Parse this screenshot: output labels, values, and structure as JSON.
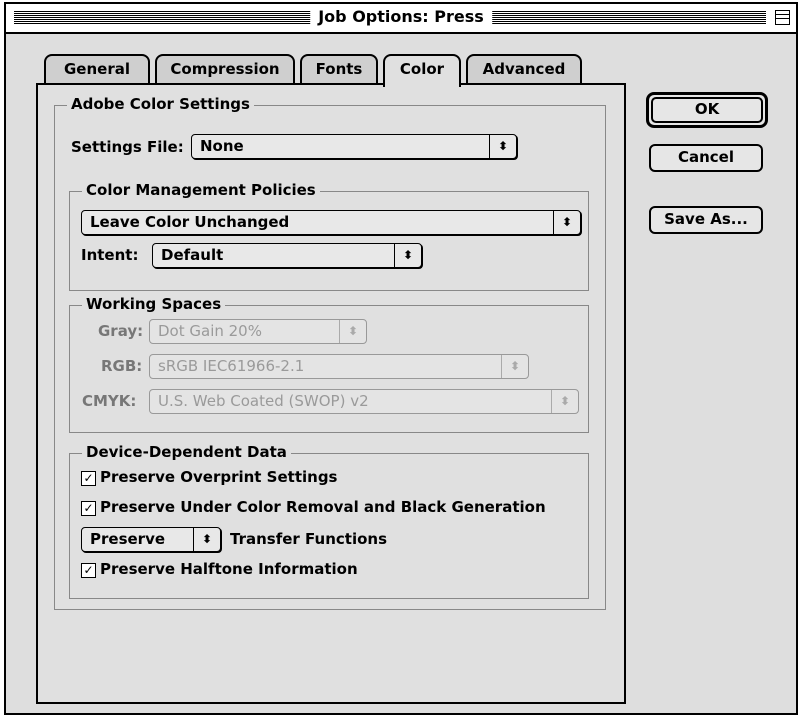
{
  "window": {
    "title": "Job Options: Press"
  },
  "tabs": [
    {
      "label": "General"
    },
    {
      "label": "Compression"
    },
    {
      "label": "Fonts"
    },
    {
      "label": "Color",
      "active": true
    },
    {
      "label": "Advanced"
    }
  ],
  "adobe_color_settings": {
    "title": "Adobe Color Settings",
    "settings_file_label": "Settings File:",
    "settings_file_value": "None"
  },
  "color_management": {
    "title": "Color Management Policies",
    "policy_value": "Leave Color Unchanged",
    "intent_label": "Intent:",
    "intent_value": "Default"
  },
  "working_spaces": {
    "title": "Working Spaces",
    "gray_label": "Gray:",
    "gray_value": "Dot Gain 20%",
    "rgb_label": "RGB:",
    "rgb_value": "sRGB IEC61966-2.1",
    "cmyk_label": "CMYK:",
    "cmyk_value": "U.S. Web Coated (SWOP) v2"
  },
  "device_data": {
    "title": "Device-Dependent Data",
    "overprint_label": "Preserve Overprint Settings",
    "overprint_checked": true,
    "ucr_label": "Preserve Under Color Removal and Black Generation",
    "ucr_checked": true,
    "transfer_value": "Preserve",
    "transfer_label": "Transfer Functions",
    "halftone_label": "Preserve Halftone Information",
    "halftone_checked": true
  },
  "buttons": {
    "ok": "OK",
    "cancel": "Cancel",
    "save_as": "Save As..."
  },
  "glyphs": {
    "popup_arrow": "⬍",
    "check": "✓"
  }
}
